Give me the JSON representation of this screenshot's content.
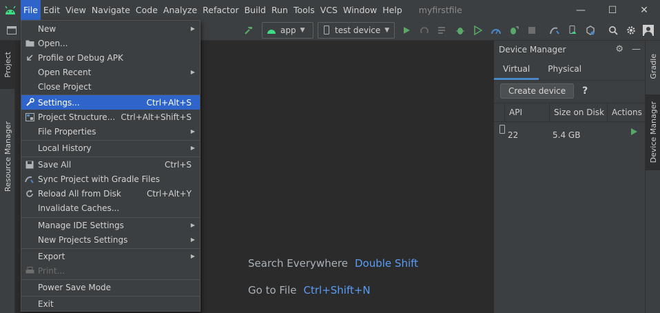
{
  "menubar": {
    "items": [
      "File",
      "Edit",
      "View",
      "Navigate",
      "Code",
      "Analyze",
      "Refactor",
      "Build",
      "Run",
      "Tools",
      "VCS",
      "Window",
      "Help"
    ],
    "active": "File",
    "project_name": "myfirstfile"
  },
  "window_controls": {
    "minimize": "—",
    "maximize": "☐",
    "close": "✕"
  },
  "toolbar": {
    "run_config": "app",
    "device_selector": "test device"
  },
  "left_strip": {
    "project_tab": "Project",
    "resource_manager_tab": "Resource Manager"
  },
  "right_strip": {
    "gradle_tab": "Gradle",
    "device_manager_tab": "Device Manager"
  },
  "editor": {
    "hints": [
      {
        "label": "Search Everywhere",
        "key": "Double Shift"
      },
      {
        "label": "Go to File",
        "key": "Ctrl+Shift+N"
      }
    ]
  },
  "device_manager": {
    "title": "Device Manager",
    "tabs": [
      "Virtual",
      "Physical"
    ],
    "active_tab": "Virtual",
    "create_button": "Create device",
    "help": "?",
    "columns": [
      "API",
      "Size on Disk",
      "Actions"
    ],
    "rows": [
      {
        "api": "22",
        "size": "5.4 GB"
      }
    ]
  },
  "file_menu": {
    "items": [
      {
        "label": "New",
        "shortcut": "",
        "submenu": true
      },
      {
        "label": "Open...",
        "shortcut": "",
        "submenu": false
      },
      {
        "label": "Profile or Debug APK",
        "shortcut": "",
        "submenu": false
      },
      {
        "label": "Open Recent",
        "shortcut": "",
        "submenu": true
      },
      {
        "label": "Close Project",
        "shortcut": "",
        "submenu": false
      },
      {
        "label": "Settings...",
        "shortcut": "Ctrl+Alt+S",
        "submenu": false
      },
      {
        "label": "Project Structure...",
        "shortcut": "Ctrl+Alt+Shift+S",
        "submenu": false
      },
      {
        "label": "File Properties",
        "shortcut": "",
        "submenu": true
      },
      {
        "label": "Local History",
        "shortcut": "",
        "submenu": true
      },
      {
        "label": "Save All",
        "shortcut": "Ctrl+S",
        "submenu": false
      },
      {
        "label": "Sync Project with Gradle Files",
        "shortcut": "",
        "submenu": false
      },
      {
        "label": "Reload All from Disk",
        "shortcut": "Ctrl+Alt+Y",
        "submenu": false
      },
      {
        "label": "Invalidate Caches...",
        "shortcut": "",
        "submenu": false
      },
      {
        "label": "Manage IDE Settings",
        "shortcut": "",
        "submenu": true
      },
      {
        "label": "New Projects Settings",
        "shortcut": "",
        "submenu": true
      },
      {
        "label": "Export",
        "shortcut": "",
        "submenu": true
      },
      {
        "label": "Print...",
        "shortcut": "",
        "submenu": false
      },
      {
        "label": "Power Save Mode",
        "shortcut": "",
        "submenu": false
      },
      {
        "label": "Exit",
        "shortcut": "",
        "submenu": false
      }
    ],
    "highlighted": "Settings...",
    "disabled": "Print..."
  },
  "colors": {
    "accent": "#2f65ca",
    "link": "#589df6",
    "run_green": "#59a869",
    "android_green": "#3ddc84"
  }
}
